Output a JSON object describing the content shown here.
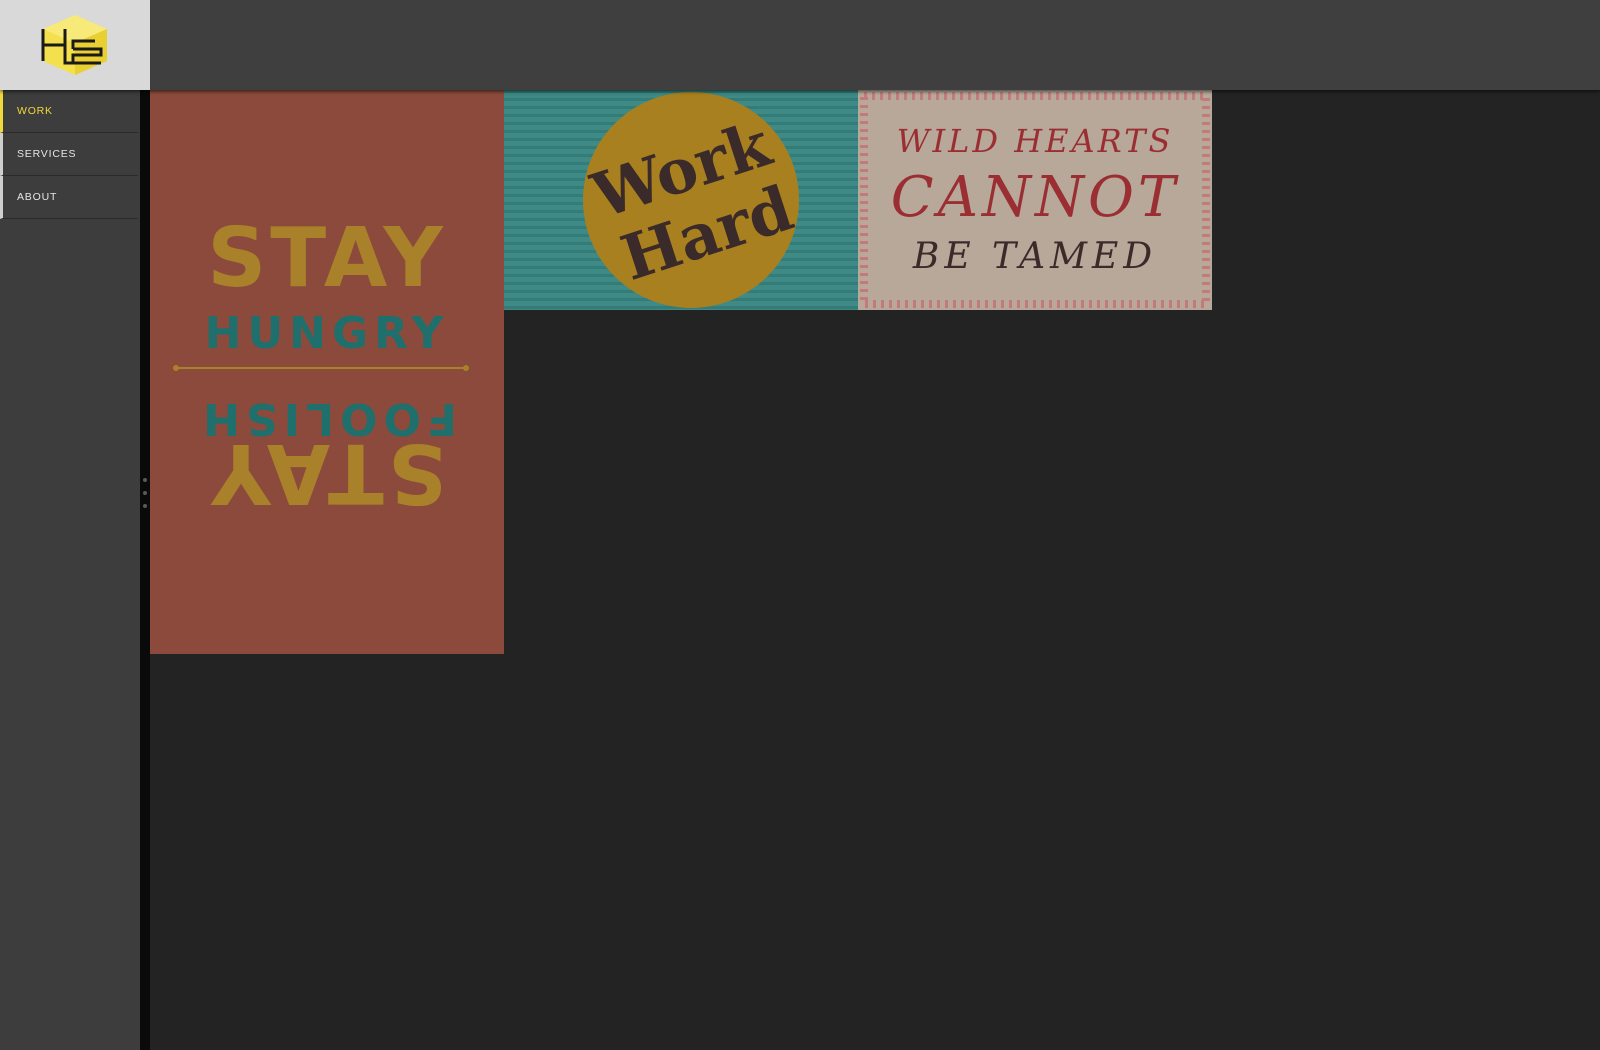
{
  "nav": {
    "items": [
      {
        "label": "WORK",
        "active": true
      },
      {
        "label": "SERVICES",
        "active": false
      },
      {
        "label": "ABOUT",
        "active": false
      }
    ]
  },
  "logo": {
    "icon": "cube-logo-icon",
    "color": "#f4e04d"
  },
  "tiles": [
    {
      "name": "stay-hungry-stay-foolish",
      "bg": "#8c4a3c",
      "lines": [
        "STAY",
        "HUNGRY",
        "FOOLISH",
        "STAY"
      ]
    },
    {
      "name": "work-hard",
      "bg": "#3e8a86",
      "lines": [
        "Work",
        "Hard"
      ]
    },
    {
      "name": "wild-hearts-cannot-be-tamed",
      "bg": "#b8a89a",
      "lines": [
        "WILD HEARTS",
        "CANNOT",
        "BE TAMED"
      ]
    }
  ],
  "colors": {
    "accent": "#f0d83a",
    "topbar": "#3f3f3f",
    "sidebar": "#3d3d3d",
    "content_bg": "#232323"
  }
}
